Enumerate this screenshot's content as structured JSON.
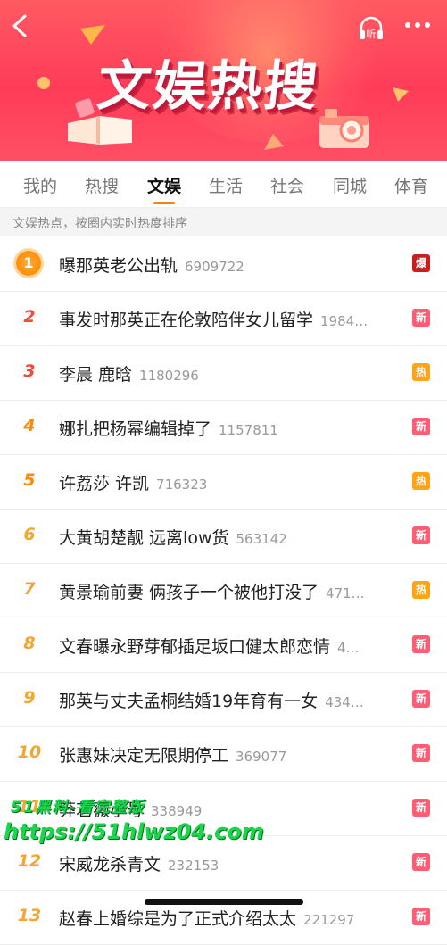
{
  "header": {
    "title": "文娱热搜",
    "listen_label": "听"
  },
  "tabs": [
    {
      "label": "我的",
      "active": false
    },
    {
      "label": "热搜",
      "active": false
    },
    {
      "label": "文娱",
      "active": true
    },
    {
      "label": "生活",
      "active": false
    },
    {
      "label": "社会",
      "active": false
    },
    {
      "label": "同城",
      "active": false
    },
    {
      "label": "体育",
      "active": false
    }
  ],
  "subtitle": "文娱热点，按圈内实时热度排序",
  "list": [
    {
      "rank": "1",
      "title": "曝那英老公出轨",
      "count": "6909722",
      "badge": "爆",
      "badge_type": "boom"
    },
    {
      "rank": "2",
      "title": "事发时那英正在伦敦陪伴女儿留学",
      "count": "1984…",
      "badge": "新",
      "badge_type": "new"
    },
    {
      "rank": "3",
      "title": "李晨 鹿晗",
      "count": "1180296",
      "badge": "热",
      "badge_type": "hot"
    },
    {
      "rank": "4",
      "title": "娜扎把杨幂编辑掉了",
      "count": "1157811",
      "badge": "新",
      "badge_type": "new"
    },
    {
      "rank": "5",
      "title": "许荔莎 许凯",
      "count": "716323",
      "badge": "热",
      "badge_type": "hot"
    },
    {
      "rank": "6",
      "title": "大黄胡楚靓 远离low货",
      "count": "563142",
      "badge": "新",
      "badge_type": "new"
    },
    {
      "rank": "7",
      "title": "黄景瑜前妻 俩孩子一个被他打没了",
      "count": "471…",
      "badge": "热",
      "badge_type": "hot"
    },
    {
      "rank": "8",
      "title": "文春曝永野芽郁插足坂口健太郎恋情",
      "count": "4…",
      "badge": "新",
      "badge_type": "new"
    },
    {
      "rank": "9",
      "title": "那英与丈夫孟桐结婚19年育有一女",
      "count": "434…",
      "badge": "新",
      "badge_type": "new"
    },
    {
      "rank": "10",
      "title": "张惠妹决定无限期停工",
      "count": "369077",
      "badge": "新",
      "badge_type": "new"
    },
    {
      "rank": "11",
      "title": "莽若薇小号",
      "count": "338949",
      "badge": "新",
      "badge_type": "new"
    },
    {
      "rank": "12",
      "title": "宋威龙杀青文",
      "count": "232153",
      "badge": "新",
      "badge_type": "new"
    },
    {
      "rank": "13",
      "title": "赵春上婚综是为了正式介绍太太",
      "count": "221297",
      "badge": "新",
      "badge_type": "new"
    }
  ],
  "watermark": {
    "line1": "51黑料-看完整版",
    "line2": "https://51hlwz04.com"
  },
  "colors": {
    "accent": "#ff8200",
    "banner_red": "#ff3c58",
    "badge_new": "#ff5d73",
    "badge_hot": "#ffa31a",
    "badge_boom": "#c81e1e"
  }
}
